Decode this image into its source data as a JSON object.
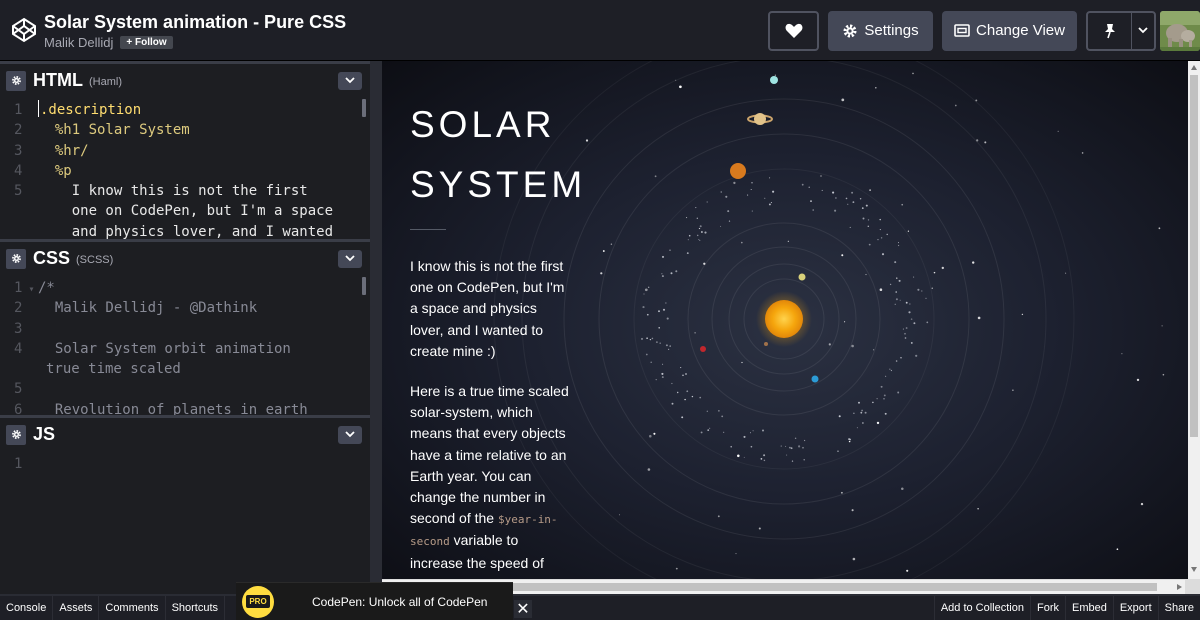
{
  "header": {
    "title": "Solar System animation - Pure CSS",
    "author": "Malik Dellidj",
    "follow_label": "+ Follow",
    "settings_label": "Settings",
    "change_view_label": "Change View"
  },
  "editors": {
    "html": {
      "lang": "HTML",
      "sub": "(Haml)",
      "lines": [
        {
          "n": "1",
          "t": ".description"
        },
        {
          "n": "2",
          "t": "  %h1 Solar System"
        },
        {
          "n": "3",
          "t": "  %hr/"
        },
        {
          "n": "4",
          "t": "  %p"
        },
        {
          "n": "5",
          "t": "    I know this is not the first"
        },
        {
          "n": "",
          "t": "    one on CodePen, but I'm a space"
        },
        {
          "n": "",
          "t": "    and physics lover, and I wanted"
        }
      ]
    },
    "css": {
      "lang": "CSS",
      "sub": "(SCSS)",
      "lines": [
        {
          "n": "1",
          "t": "/*"
        },
        {
          "n": "2",
          "t": "  Malik Dellidj - @Dathink"
        },
        {
          "n": "3",
          "t": ""
        },
        {
          "n": "4",
          "t": "  Solar System orbit animation"
        },
        {
          "n": "",
          "t": "true time scaled"
        },
        {
          "n": "5",
          "t": ""
        },
        {
          "n": "6",
          "t": "  Revolution of planets in earth"
        }
      ]
    },
    "js": {
      "lang": "JS",
      "lines": [
        {
          "n": "1",
          "t": ""
        }
      ]
    }
  },
  "preview": {
    "title_line1": "SOLAR",
    "title_line2": "SYSTEM",
    "p1": "I know this is not the first one on CodePen, but I'm a space and physics lover, and I wanted to create mine :)",
    "p2_a": "Here is a true time scaled solar-system, which means that every objects have a time relative to an Earth year. You can change the number in second of the",
    "p2_var": "$year-in-second",
    "p2_b": "variable to increase the speed of revolution"
  },
  "footer": {
    "left": [
      "Console",
      "Assets",
      "Comments",
      "Shortcuts"
    ],
    "right": [
      "Add to Collection",
      "Fork",
      "Embed",
      "Export",
      "Share"
    ]
  },
  "promo": {
    "badge": "PRO",
    "text": "CodePen: Unlock all of CodePen",
    "close": "✕"
  },
  "colors": {
    "sun": "#f5a50c",
    "accent_bar": "#444857",
    "background": "#1e1f26"
  },
  "icons": {
    "logo": "codepen-logo-icon",
    "heart": "heart-icon",
    "settings": "gear-icon",
    "change_view": "layout-icon",
    "pin": "pin-icon",
    "caret": "chevron-down-icon"
  }
}
